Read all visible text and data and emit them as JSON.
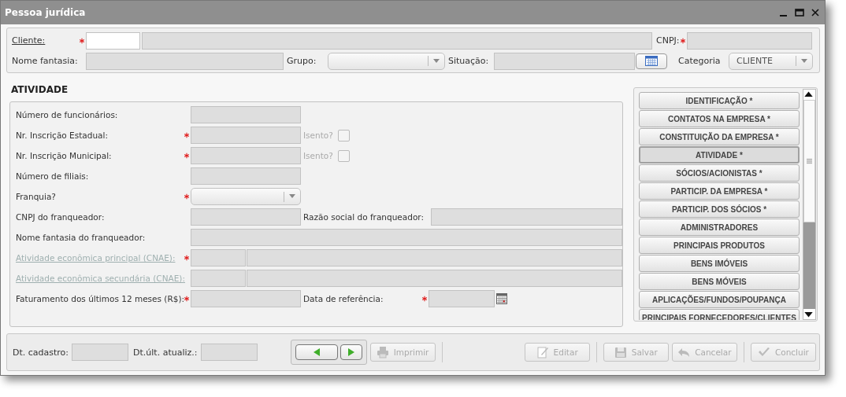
{
  "window": {
    "title": "Pessoa jurídica"
  },
  "header": {
    "cliente_label": "Cliente:",
    "cliente_required": true,
    "cnpj_label": "CNPJ:",
    "cnpj_required": true,
    "nome_fantasia_label": "Nome fantasia:",
    "grupo_label": "Grupo:",
    "situacao_label": "Situação:",
    "categoria_label": "Categoria",
    "categoria_value": "CLIENTE"
  },
  "section": {
    "title": "ATIVIDADE",
    "rows": [
      {
        "kind": "text",
        "label": "Número de funcionários:",
        "required": false
      },
      {
        "kind": "check",
        "label": "Nr. Inscrição Estadual:",
        "required": true,
        "check_label": "Isento?",
        "checked": false
      },
      {
        "kind": "check",
        "label": "Nr. Inscrição Municipal:",
        "required": true,
        "check_label": "Isento?",
        "checked": false
      },
      {
        "kind": "text",
        "label": "Número de filiais:",
        "required": false
      },
      {
        "kind": "select",
        "label": "Franquia?",
        "required": true
      },
      {
        "kind": "pair",
        "label": "CNPJ do franqueador:",
        "required": false,
        "second_label": "Razão social do franqueador:"
      },
      {
        "kind": "wide",
        "label": "Nome fantasia do franqueador:",
        "required": false
      },
      {
        "kind": "cnae",
        "label": "Atividade econômica principal (CNAE):",
        "required": true,
        "disabled": true
      },
      {
        "kind": "cnae",
        "label": "Atividade econômica secundária (CNAE):",
        "required": false,
        "disabled": true
      },
      {
        "kind": "date",
        "label": "Faturamento dos últimos 12 meses (R$):",
        "required": true,
        "second_label": "Data de referência:",
        "second_required": true
      }
    ]
  },
  "nav": [
    {
      "label": "IDENTIFICAÇÃO *",
      "selected": false
    },
    {
      "label": "CONTATOS NA EMPRESA *",
      "selected": false
    },
    {
      "label": "CONSTITUIÇÃO DA EMPRESA *",
      "selected": false
    },
    {
      "label": "ATIVIDADE *",
      "selected": true
    },
    {
      "label": "SÓCIOS/ACIONISTAS *",
      "selected": false
    },
    {
      "label": "PARTICIP. DA EMPRESA *",
      "selected": false
    },
    {
      "label": "PARTICIP. DOS SÓCIOS *",
      "selected": false
    },
    {
      "label": "ADMINISTRADORES",
      "selected": false
    },
    {
      "label": "PRINCIPAIS PRODUTOS",
      "selected": false
    },
    {
      "label": "BENS IMÓVEIS",
      "selected": false
    },
    {
      "label": "BENS MÓVEIS",
      "selected": false
    },
    {
      "label": "APLICAÇÕES/FUNDOS/POUPANÇA",
      "selected": false
    },
    {
      "label": "PRINCIPAIS FORNECEDORES/CLIENTES",
      "selected": false
    }
  ],
  "footer": {
    "cadastro_label": "Dt. cadastro:",
    "atualiz_label": "Dt.últ. atualiz.:",
    "buttons": [
      {
        "kind": "print",
        "label": "Imprimir",
        "disabled": true
      },
      {
        "kind": "edit",
        "label": "Editar",
        "disabled": true
      },
      {
        "kind": "save",
        "label": "Salvar",
        "disabled": true
      },
      {
        "kind": "cancel",
        "label": "Cancelar",
        "disabled": true
      },
      {
        "kind": "done",
        "label": "Concluir",
        "disabled": true
      }
    ]
  }
}
